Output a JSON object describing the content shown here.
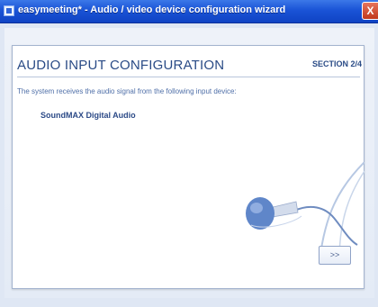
{
  "window": {
    "title": "easymeeting* - Audio / video device configuration wizard",
    "close_label": "X"
  },
  "section": {
    "title": "AUDIO INPUT CONFIGURATION",
    "number": "SECTION 2/4"
  },
  "content": {
    "description": "The system receives the audio signal from the following input device:",
    "device_name": "SoundMAX Digital Audio"
  },
  "buttons": {
    "next_label": ">>"
  },
  "icons": {
    "app_icon": "window-app-icon",
    "microphone": "microphone-icon"
  },
  "colors": {
    "title_bar": "#1a53d6",
    "accent_text": "#2a4b86",
    "close_button": "#c0391d"
  }
}
